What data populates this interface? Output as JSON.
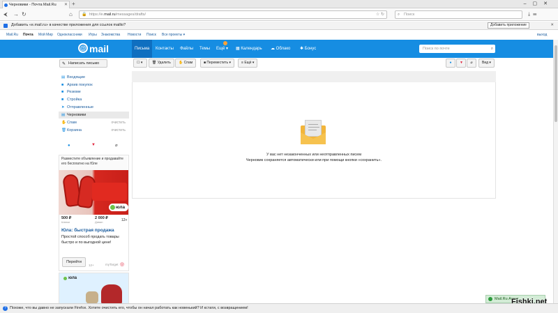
{
  "browser": {
    "tab_title": "Черновики - Почта Mail.Ru",
    "url_prefix": "https://e.",
    "url_domain": "mail.ru",
    "url_path": "/messages/drafts/",
    "search_placeholder": "Поиск"
  },
  "notification": {
    "text": "Добавить «e.mail.ru» в качестве приложения для ссылок mailto?",
    "button": "Добавить приложение"
  },
  "portal": {
    "items": [
      "Mail.Ru",
      "Почта",
      "Мой Мир",
      "Одноклассники",
      "Игры",
      "Знакомства",
      "Новости",
      "Поиск",
      "Все проекты ▾"
    ],
    "exit": "выход"
  },
  "header": {
    "logo": "mail",
    "nav": [
      "Письма",
      "Контакты",
      "Файлы",
      "Темы",
      "Ещё ▾",
      "Календарь",
      "Облако",
      "Бонус"
    ],
    "search_placeholder": "Поиск по почте"
  },
  "sidebar": {
    "compose": "Написать письмо",
    "folders": [
      {
        "label": "Входящие",
        "icon": "inbox-icon",
        "clear": ""
      },
      {
        "label": "Архив покупок",
        "icon": "folder-icon",
        "clear": ""
      },
      {
        "label": "Резюме",
        "icon": "folder-icon",
        "clear": ""
      },
      {
        "label": "Стройка",
        "icon": "folder-icon",
        "clear": ""
      },
      {
        "label": "Отправленные",
        "icon": "sent-icon",
        "clear": ""
      },
      {
        "label": "Черновики",
        "icon": "drafts-icon",
        "clear": ""
      },
      {
        "label": "Спам",
        "icon": "spam-icon",
        "clear": "очистить"
      },
      {
        "label": "Корзина",
        "icon": "trash-icon",
        "clear": "очистить"
      }
    ]
  },
  "ad": {
    "top_text": "Разместите объявление и продавайте его бесплатно на Юле",
    "price1": "500 ₽",
    "price1_sub": "Шапки",
    "price2": "2 000 ₽",
    "price2_sub": "Диван",
    "age": "12+",
    "brand": "юла",
    "title": "Юла: быстрая продажа",
    "text": "Простой способ продать товары быстро и по выгодной цене!",
    "button": "Перейти",
    "age2": "12+",
    "target": "myTarget"
  },
  "toolbar": {
    "delete": "Удалить",
    "spam": "Спам",
    "move": "Переместить ▾",
    "more": "Ещё ▾",
    "view": "Вид ▾"
  },
  "empty": {
    "line1": "У вас нет незаконченных или неотправленных писем",
    "line2": "Черновик сохраняется автоматически или при помощи кнопки «сохранить»."
  },
  "statusbar": {
    "text": "Похоже, что вы давно не запускали Firefox. Хотите очистить его, чтобы он начал работать как новенький? И кстати, с возвращением!"
  },
  "agent": {
    "label": "Mail.Ru Агент"
  },
  "watermark": "Fishki.net"
}
